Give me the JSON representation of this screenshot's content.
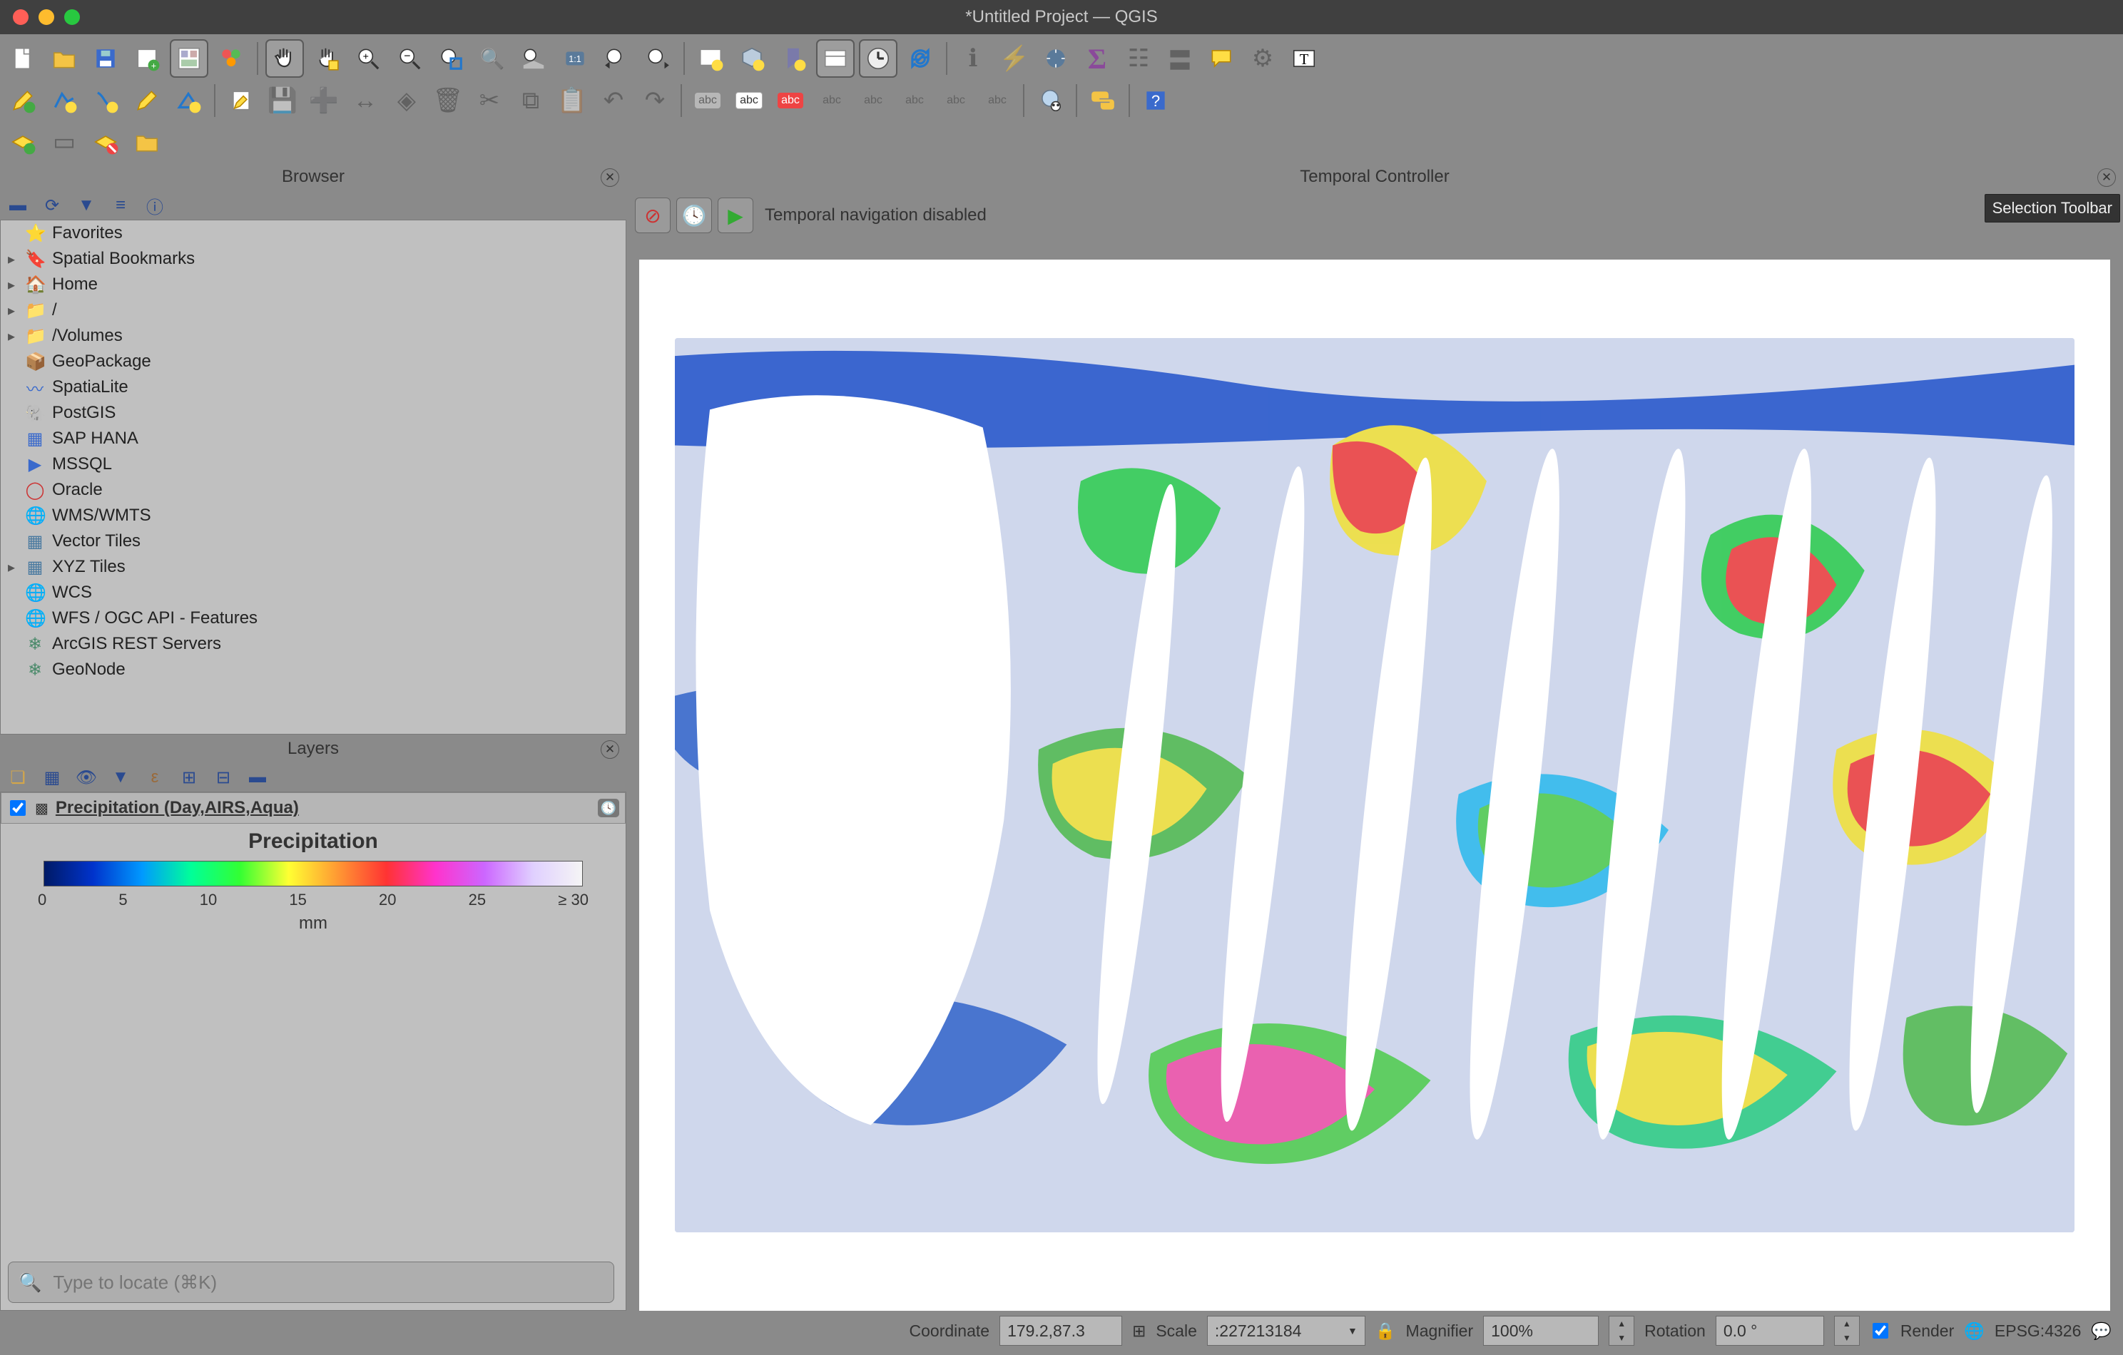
{
  "window": {
    "title": "*Untitled Project — QGIS"
  },
  "panels": {
    "browser": {
      "title": "Browser"
    },
    "layers": {
      "title": "Layers"
    },
    "temporal": {
      "title": "Temporal Controller",
      "status": "Temporal navigation disabled"
    }
  },
  "tooltip": "Selection Toolbar",
  "browser_items": [
    {
      "icon": "⭐",
      "label": "Favorites",
      "exp": false,
      "color": "#f5c518"
    },
    {
      "icon": "🔖",
      "label": "Spatial Bookmarks",
      "exp": true,
      "color": "#5a5a8a"
    },
    {
      "icon": "🏠",
      "label": "Home",
      "exp": true,
      "color": "#555"
    },
    {
      "icon": "📁",
      "label": "/",
      "exp": true,
      "color": "#555"
    },
    {
      "icon": "📁",
      "label": "/Volumes",
      "exp": true,
      "color": "#555"
    },
    {
      "icon": "📦",
      "label": "GeoPackage",
      "exp": false,
      "color": "#d4a64a"
    },
    {
      "icon": "〰",
      "label": "SpatiaLite",
      "exp": false,
      "color": "#3a6acc"
    },
    {
      "icon": "🐘",
      "label": "PostGIS",
      "exp": false,
      "color": "#4a7aa0"
    },
    {
      "icon": "▦",
      "label": "SAP HANA",
      "exp": false,
      "color": "#3a6acc"
    },
    {
      "icon": "▶",
      "label": "MSSQL",
      "exp": false,
      "color": "#3a6acc"
    },
    {
      "icon": "◯",
      "label": "Oracle",
      "exp": false,
      "color": "#c33"
    },
    {
      "icon": "🌐",
      "label": "WMS/WMTS",
      "exp": false,
      "color": "#4a7aa0"
    },
    {
      "icon": "▦",
      "label": "Vector Tiles",
      "exp": false,
      "color": "#4a7aa0"
    },
    {
      "icon": "▦",
      "label": "XYZ Tiles",
      "exp": true,
      "color": "#4a7aa0"
    },
    {
      "icon": "🌐",
      "label": "WCS",
      "exp": false,
      "color": "#4a7aa0"
    },
    {
      "icon": "🌐",
      "label": "WFS / OGC API - Features",
      "exp": false,
      "color": "#4a7aa0"
    },
    {
      "icon": "❄",
      "label": "ArcGIS REST Servers",
      "exp": false,
      "color": "#4a8a6a"
    },
    {
      "icon": "❄",
      "label": "GeoNode",
      "exp": false,
      "color": "#4a8a6a"
    }
  ],
  "layers": {
    "items": [
      {
        "name": "Precipitation (Day,AIRS,Aqua)",
        "checked": true
      }
    ],
    "legend": {
      "title": "Precipitation",
      "unit": "mm",
      "ticks": [
        "0",
        "5",
        "10",
        "15",
        "20",
        "25",
        "≥ 30"
      ]
    }
  },
  "locator": {
    "placeholder": "Type to locate (⌘K)"
  },
  "statusbar": {
    "coord_label": "Coordinate",
    "coord": "179.2,87.3",
    "scale_label": "Scale",
    "scale": ":227213184",
    "mag_label": "Magnifier",
    "mag": "100%",
    "rot_label": "Rotation",
    "rot": "0.0 °",
    "render": "Render",
    "crs": "EPSG:4326"
  }
}
